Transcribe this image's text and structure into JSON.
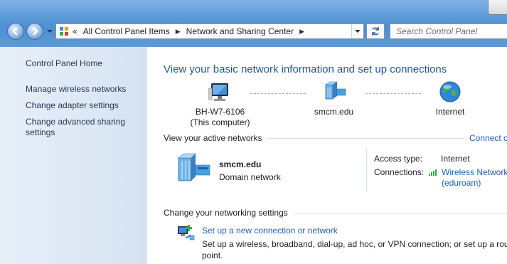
{
  "address_bar": {
    "breadcrumb": [
      "All Control Panel Items",
      "Network and Sharing Center"
    ],
    "overflow_glyph": "«",
    "separator_glyph": "▶"
  },
  "search": {
    "placeholder": "Search Control Panel"
  },
  "sidebar": {
    "home": "Control Panel Home",
    "links": [
      {
        "lines": [
          "Manage wireless networks"
        ]
      },
      {
        "lines": [
          "Change adapter settings"
        ]
      },
      {
        "lines": [
          "Change advanced sharing",
          "settings"
        ]
      }
    ]
  },
  "main": {
    "title": "View your basic network information and set up connections",
    "map": {
      "computer": {
        "name": "BH-W7-6106",
        "sub": "(This computer)",
        "icon": "computer-icon"
      },
      "network": {
        "name": "smcm.edu",
        "icon": "network-icon"
      },
      "internet": {
        "name": "Internet",
        "icon": "globe-icon"
      }
    },
    "active": {
      "heading": "View your active networks",
      "connect_link": "Connect o",
      "network_name": "smcm.edu",
      "network_type": "Domain network",
      "access_label": "Access type:",
      "access_value": "Internet",
      "connections_label": "Connections:",
      "connection_link_line1": "Wireless Network",
      "connection_link_line2": "(eduroam)"
    },
    "settings": {
      "heading": "Change your networking settings",
      "item_link": "Set up a new connection or network",
      "item_desc_line1": "Set up a wireless, broadband, dial-up, ad hoc, or VPN connection; or set up a rout",
      "item_desc_line2": "point."
    }
  },
  "colors": {
    "link": "#1f5faf",
    "title": "#1e5a9c",
    "sidebar_link": "#1e395b"
  }
}
